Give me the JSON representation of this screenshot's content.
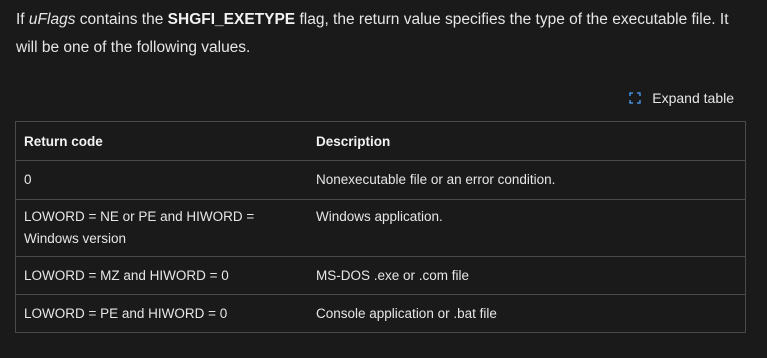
{
  "intro": {
    "prefix": "If ",
    "param": "uFlags",
    "middle": " contains the ",
    "flag": "SHGFI_EXETYPE",
    "suffix": " flag, the return value specifies the type of the executable file. It will be one of the following values."
  },
  "expand_label": "Expand table",
  "table": {
    "headers": [
      "Return code",
      "Description"
    ],
    "rows": [
      {
        "code": "0",
        "description": "Nonexecutable file or an error condition."
      },
      {
        "code": "LOWORD = NE or PE and HIWORD = Windows version",
        "description": "Windows application."
      },
      {
        "code": "LOWORD = MZ and HIWORD = 0",
        "description": "MS-DOS .exe or .com file"
      },
      {
        "code": "LOWORD = PE and HIWORD = 0",
        "description": "Console application or .bat file"
      }
    ]
  }
}
